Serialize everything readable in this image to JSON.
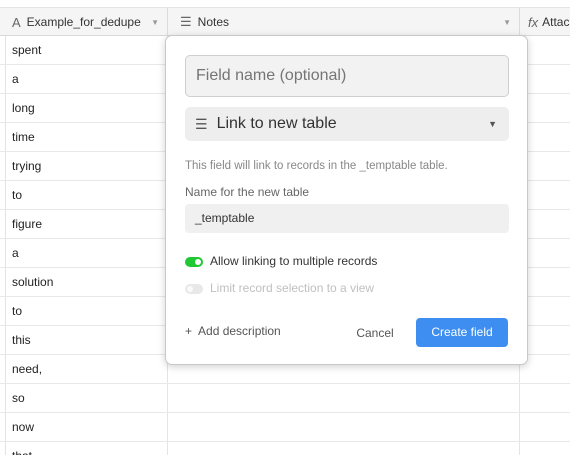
{
  "header": {
    "col1": {
      "icon": "text-field-icon",
      "label": "Example_for_dedupe"
    },
    "col2": {
      "icon": "long-text-icon",
      "label": "Notes"
    },
    "col3": {
      "icon": "formula-icon",
      "label": "Attac"
    }
  },
  "rows": [
    "spent",
    "a",
    "long",
    "time",
    "trying",
    "to",
    "figure",
    "a",
    "solution",
    "to",
    "this",
    "need,",
    "so",
    "now",
    "that"
  ],
  "dialog": {
    "field_name_placeholder": "Field name (optional)",
    "field_type": {
      "icon": "link-icon",
      "label": "Link to new table"
    },
    "description": "This field will link to records in the _temptable table.",
    "new_table_label": "Name for the new table",
    "new_table_value": "_temptable",
    "toggle_multiple": {
      "label": "Allow linking to multiple records",
      "on": true
    },
    "toggle_limit": {
      "label": "Limit record selection to a view",
      "on": false
    },
    "add_description": "Add description",
    "cancel": "Cancel",
    "create": "Create field"
  },
  "colors": {
    "accent": "#3d8ef0",
    "toggle_on": "#20c933"
  }
}
